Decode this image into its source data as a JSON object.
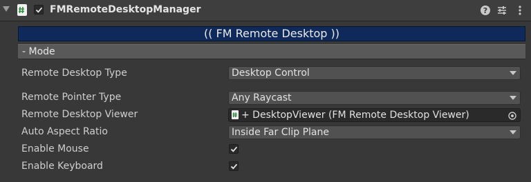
{
  "header": {
    "title": "FMRemoteDesktopManager",
    "enabled": true,
    "icons": [
      "foldout-arrow-icon",
      "script-icon",
      "help-icon",
      "preset-icon",
      "more-menu-icon"
    ]
  },
  "banner": {
    "text": "(( FM Remote Desktop ))"
  },
  "mode_section": {
    "label": "- Mode"
  },
  "fields": {
    "remote_desktop_type": {
      "label": "Remote Desktop Type",
      "value": "Desktop Control"
    },
    "remote_pointer_type": {
      "label": "Remote Pointer Type",
      "value": "Any Raycast"
    },
    "remote_desktop_viewer": {
      "label": "Remote Desktop Viewer",
      "value": "+ DesktopViewer (FM Remote Desktop Viewer)"
    },
    "auto_aspect_ratio": {
      "label": "Auto Aspect Ratio",
      "value": "Inside Far Clip Plane"
    },
    "enable_mouse": {
      "label": "Enable Mouse",
      "checked": true
    },
    "enable_keyboard": {
      "label": "Enable Keyboard",
      "checked": true
    }
  },
  "colors": {
    "background": "#383838",
    "banner": "#0f2a5a",
    "mode_bar": "#595959"
  }
}
